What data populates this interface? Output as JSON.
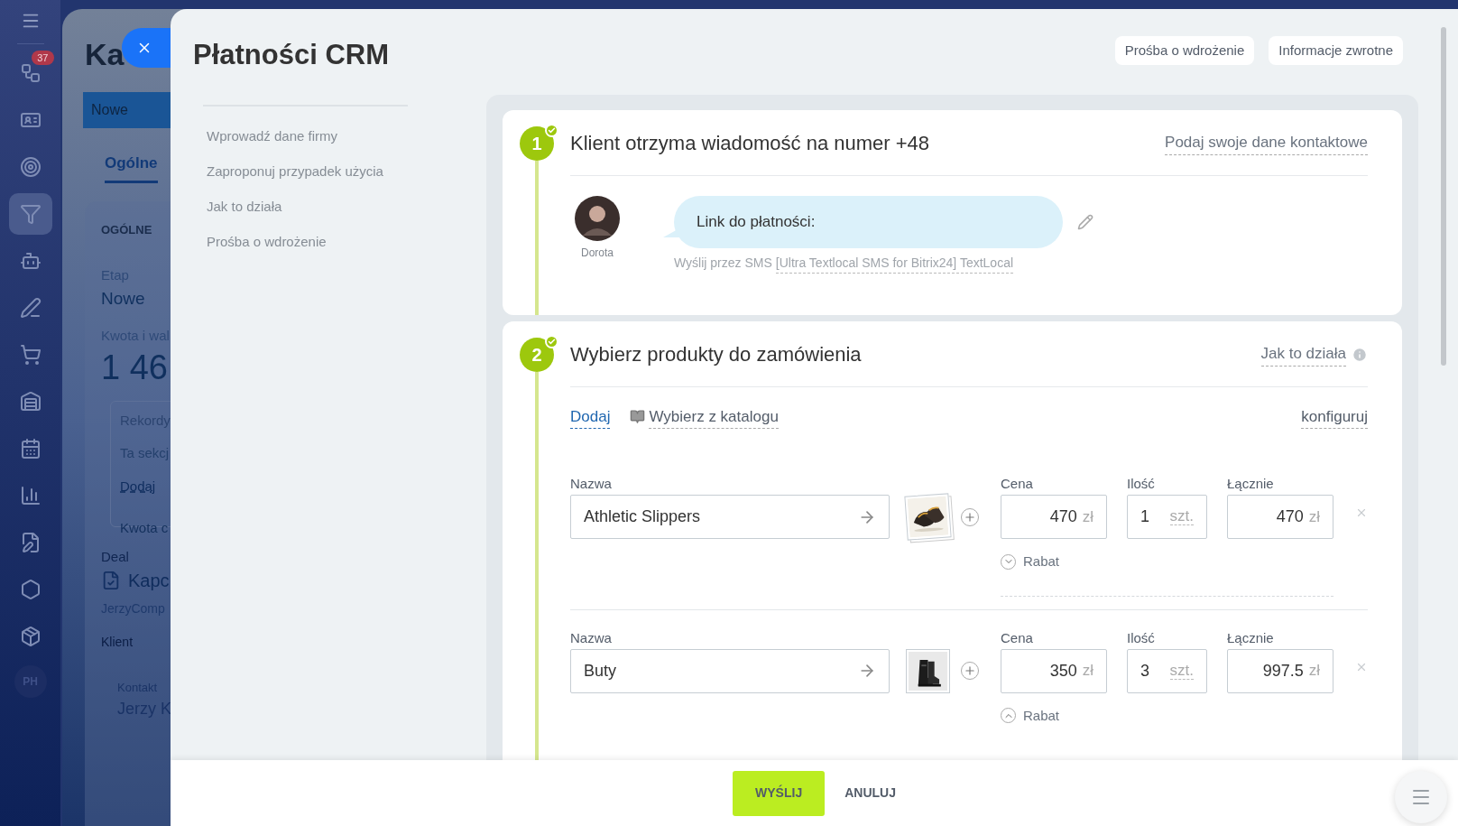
{
  "left_nav": {
    "badge": "37",
    "avatar": "PH",
    "items": [
      {
        "selected": false
      },
      {
        "selected": false
      },
      {
        "selected": false
      },
      {
        "selected": true
      },
      {
        "selected": false
      },
      {
        "selected": false
      },
      {
        "selected": false
      },
      {
        "selected": false
      },
      {
        "selected": false
      },
      {
        "selected": false
      },
      {
        "selected": false
      },
      {
        "selected": false
      },
      {
        "selected": false
      }
    ]
  },
  "background_page": {
    "title": "Ka",
    "stage_button": "Nowe",
    "tab": "Ogólne",
    "section": "OGÓLNE",
    "fields": [
      {
        "label": "Etap",
        "value": "Nowe"
      },
      {
        "label": "Kwota i wal",
        "value": "1 46"
      }
    ],
    "records": {
      "label": "Rekordy",
      "text": "Ta sekcj",
      "link": "Dodaj",
      "footer": "Kwota c"
    },
    "deal": {
      "label": "Deal",
      "value": "Kapc",
      "company": "JerzyComp"
    },
    "client": {
      "label": "Klient"
    },
    "contact": {
      "label": "Kontakt",
      "value": "Jerzy K"
    }
  },
  "slider": {
    "title": "Płatności CRM",
    "header_buttons": [
      "Prośba o wdrożenie",
      "Informacje zwrotne"
    ],
    "nav": [
      "Wprowadź dane firmy",
      "Zaproponuj przypadek użycia",
      "Jak to działa",
      "Prośba o wdrożenie"
    ],
    "steps": [
      {
        "kind": "message",
        "number": "1",
        "done": true,
        "title": "Klient otrzyma wiadomość na numer +48",
        "link": "Podaj swoje dane kontaktowe",
        "sender": "Dorota",
        "message": "Link do płatności:",
        "note": "Wyślij przez SMS",
        "note_link": "[Ultra Textlocal SMS for Bitrix24] TextLocal"
      },
      {
        "kind": "products",
        "number": "2",
        "done": true,
        "title": "Wybierz produkty do zamówienia",
        "link": "Jak to działa",
        "actions": [
          "Dodaj",
          "Wybierz z katalogu"
        ],
        "configure": "konfiguruj",
        "products": [
          {
            "name_label": "Nazwa",
            "name": "Athletic Slippers",
            "price_label": "Cena",
            "price": "470",
            "currency": "zł",
            "qty_label": "Ilość",
            "qty": "1",
            "unit": "szt.",
            "total_label": "Łącznie",
            "total": "470",
            "total_currency": "zł",
            "discount": "Rabat",
            "discount_expanded": false,
            "stacked_images": true
          },
          {
            "name_label": "Nazwa",
            "name": "Buty",
            "price_label": "Cena",
            "price": "350",
            "currency": "zł",
            "qty_label": "Ilość",
            "qty": "3",
            "unit": "szt.",
            "total_label": "Łącznie",
            "total": "997.5",
            "total_currency": "zł",
            "discount": "Rabat",
            "discount_expanded": true,
            "stacked_images": false
          }
        ]
      }
    ],
    "footer_buttons": [
      {
        "label": "WYŚLIJ",
        "kind": "primary"
      },
      {
        "label": "ANULUJ",
        "kind": "link"
      }
    ]
  }
}
